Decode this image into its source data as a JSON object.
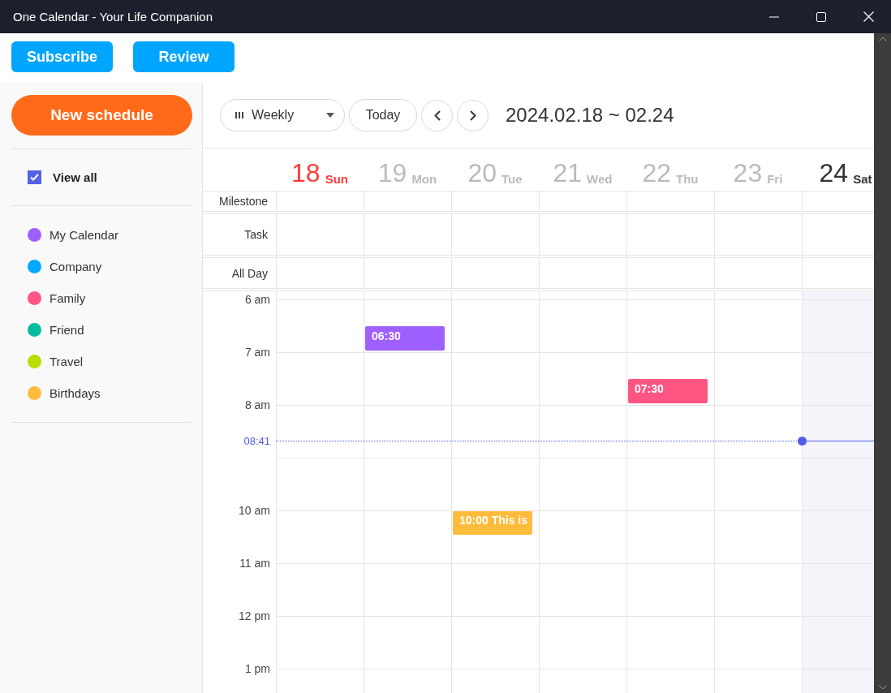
{
  "window": {
    "title": "One Calendar - Your Life Companion"
  },
  "top_buttons": [
    "Subscribe",
    "Review"
  ],
  "sidebar": {
    "new_button": "New schedule",
    "view_all": {
      "label": "View all",
      "checked": true
    },
    "calendars": [
      {
        "name": "My Calendar",
        "color": "#9e5fff"
      },
      {
        "name": "Company",
        "color": "#00a9ff"
      },
      {
        "name": "Family",
        "color": "#ff5583"
      },
      {
        "name": "Friend",
        "color": "#03bd9e"
      },
      {
        "name": "Travel",
        "color": "#bbdc00"
      },
      {
        "name": "Birthdays",
        "color": "#ffbb3b"
      }
    ]
  },
  "toolbar": {
    "view": "Weekly",
    "today": "Today",
    "range": "2024.02.18 ~ 02.24"
  },
  "days": [
    {
      "date": "18",
      "weekday": "Sun",
      "kind": "sunday"
    },
    {
      "date": "19",
      "weekday": "Mon",
      "kind": "past",
      "events": [
        {
          "time": "06:30",
          "color": "#9e5fff"
        }
      ]
    },
    {
      "date": "20",
      "weekday": "Tue",
      "kind": "past",
      "events": [
        {
          "time": "10:00",
          "title": "This is",
          "color": "#ffbb3b"
        }
      ]
    },
    {
      "date": "21",
      "weekday": "Wed",
      "kind": "past"
    },
    {
      "date": "22",
      "weekday": "Thu",
      "kind": "past",
      "events": [
        {
          "time": "07:30",
          "color": "#ff5583"
        }
      ]
    },
    {
      "date": "23",
      "weekday": "Fri",
      "kind": "past"
    },
    {
      "date": "24",
      "weekday": "Sat",
      "kind": "today"
    }
  ],
  "rows": [
    "Milestone",
    "Task",
    "All Day"
  ],
  "hours": [
    {
      "kind": "labeled",
      "label": "6 am"
    },
    {
      "kind": "labeled",
      "label": "7 am"
    },
    {
      "kind": "labeled",
      "label": "8 am"
    },
    {
      "kind": "covered"
    },
    {
      "kind": "labeled",
      "label": "10 am"
    },
    {
      "kind": "labeled",
      "label": "11 am"
    },
    {
      "kind": "labeled",
      "label": "12 pm"
    },
    {
      "kind": "labeled",
      "label": "1 pm"
    }
  ],
  "now": {
    "time": "08:41"
  }
}
